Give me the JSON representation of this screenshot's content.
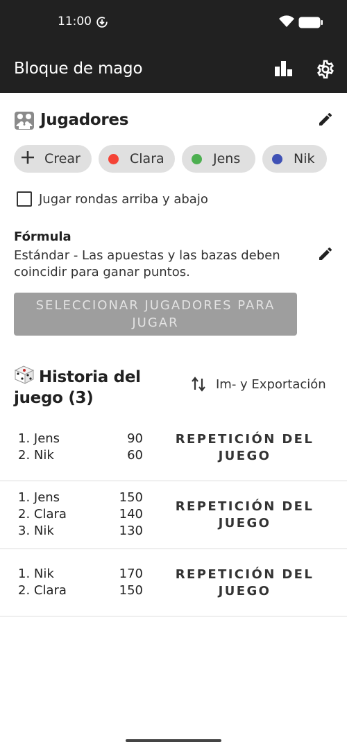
{
  "status_bar": {
    "time": "11:00"
  },
  "app_bar": {
    "title": "Bloque de mago"
  },
  "players_section": {
    "title": "Jugadores",
    "create_label": "Crear",
    "players": [
      {
        "name": "Clara",
        "color": "#f44336"
      },
      {
        "name": "Jens",
        "color": "#4caf50"
      },
      {
        "name": "Nik",
        "color": "#3f51b5"
      }
    ],
    "checkbox_label": "Jugar rondas arriba y abajo",
    "checkbox_checked": false
  },
  "formula": {
    "title": "Fórmula",
    "description": "Estándar - Las apuestas y las bazas deben coincidir para ganar puntos."
  },
  "select_button": {
    "label": "SELECCIONAR JUGADORES PARA JUGAR"
  },
  "history": {
    "title": "Historia del juego (3)",
    "impexp_label": "Im- y Exportación",
    "games": [
      {
        "results": [
          {
            "name": "1. Jens",
            "score": "90"
          },
          {
            "name": "2. Nik",
            "score": "60"
          }
        ],
        "replay_label": "REPETICIÓN DEL JUEGO"
      },
      {
        "results": [
          {
            "name": "1. Jens",
            "score": "150"
          },
          {
            "name": "2. Clara",
            "score": "140"
          },
          {
            "name": "3. Nik",
            "score": "130"
          }
        ],
        "replay_label": "REPETICIÓN DEL JUEGO"
      },
      {
        "results": [
          {
            "name": "1. Nik",
            "score": "170"
          },
          {
            "name": "2. Clara",
            "score": "150"
          }
        ],
        "replay_label": "REPETICIÓN DEL JUEGO"
      }
    ]
  }
}
